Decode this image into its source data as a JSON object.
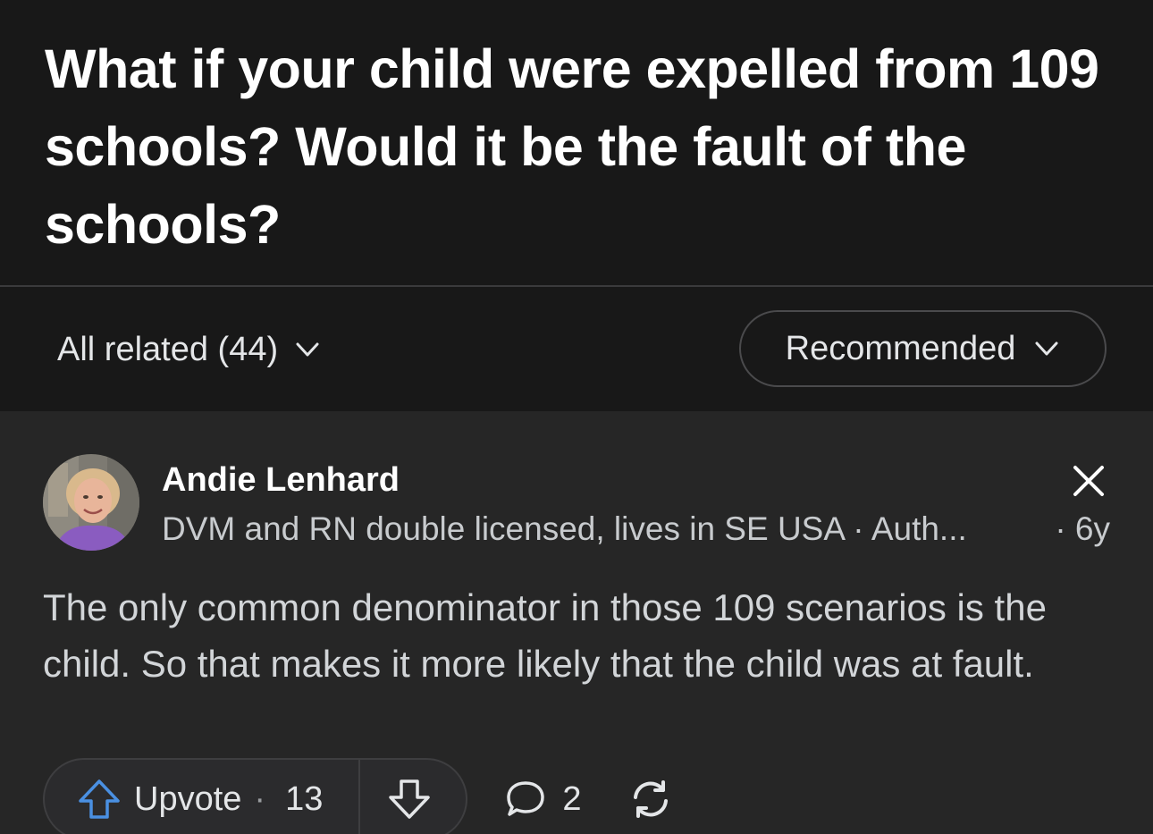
{
  "question": {
    "title": "What if your child were expelled from 109 schools? Would it be the fault of the schools?"
  },
  "filters": {
    "all_related_label": "All related (44)",
    "sort_label": "Recommended"
  },
  "answer": {
    "author_name": "Andie Lenhard",
    "author_credential": "DVM and RN double licensed, lives in SE USA · Auth...",
    "timestamp": "· 6y",
    "body": "The only common denominator in those 109 scenarios is the child. So that makes it more likely that the child was at fault.",
    "upvote_label": "Upvote",
    "upvote_separator": "·",
    "upvote_count": "13",
    "comment_count": "2"
  },
  "colors": {
    "upvote_accent": "#4a90e2",
    "background": "#181818",
    "card_background": "#262626"
  },
  "icons": {
    "chevron": "chevron-down-icon",
    "close": "close-icon",
    "upvote": "upvote-arrow-icon",
    "downvote": "downvote-arrow-icon",
    "comment": "comment-bubble-icon",
    "share": "share-refresh-icon"
  }
}
